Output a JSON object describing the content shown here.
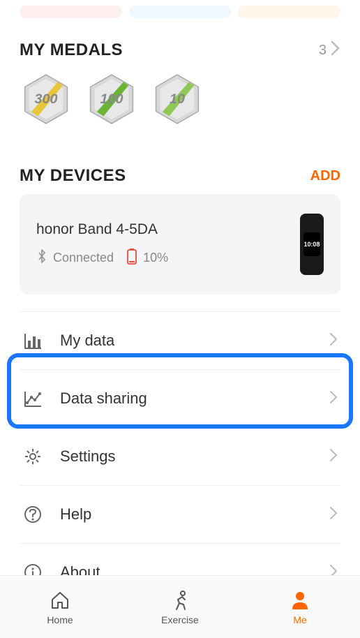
{
  "medals": {
    "title": "MY MEDALS",
    "count": "3",
    "badges": [
      {
        "value": "300"
      },
      {
        "value": "100"
      },
      {
        "value": "10"
      }
    ]
  },
  "devices": {
    "title": "MY DEVICES",
    "add_label": "ADD",
    "device": {
      "name": "honor Band 4-5DA",
      "status": "Connected",
      "battery": "10%",
      "screen_time": "10:08"
    }
  },
  "menu": {
    "my_data": "My data",
    "data_sharing": "Data sharing",
    "settings": "Settings",
    "help": "Help",
    "about": "About"
  },
  "nav": {
    "home": "Home",
    "exercise": "Exercise",
    "me": "Me"
  }
}
